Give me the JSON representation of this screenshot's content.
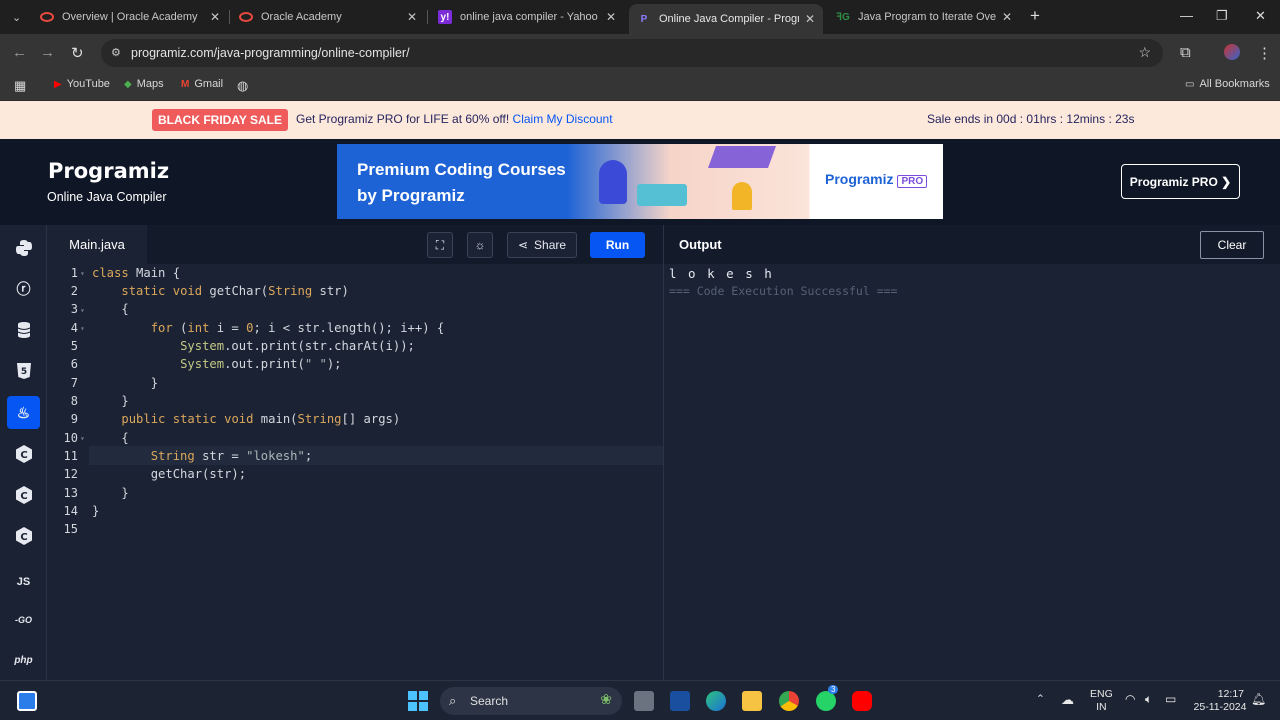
{
  "browser": {
    "tabs": [
      {
        "title": "Overview | Oracle Academy",
        "favicon": "oracle-icon",
        "color": "#e94a3f"
      },
      {
        "title": "Oracle Academy",
        "favicon": "oracle-icon",
        "color": "#e94a3f"
      },
      {
        "title": "online java compiler - Yahoo In",
        "favicon": "yahoo-icon",
        "color": "#7b2bd8"
      },
      {
        "title": "Online Java Compiler - Program",
        "favicon": "programiz-icon",
        "color": "#6a5bff"
      },
      {
        "title": "Java Program to Iterate Over Ch",
        "favicon": "gfg-icon",
        "color": "#2f8d46"
      }
    ],
    "url": "programiz.com/java-programming/online-compiler/",
    "bookmarks": [
      {
        "label": "YouTube",
        "icon": "youtube-icon"
      },
      {
        "label": "Maps",
        "icon": "maps-icon"
      },
      {
        "label": "Gmail",
        "icon": "gmail-icon"
      }
    ],
    "all_bookmarks": "All Bookmarks"
  },
  "promo": {
    "badge": "BLACK FRIDAY SALE",
    "text": "Get Programiz PRO for LIFE at 60% off!",
    "link": "Claim My Discount",
    "timer": "Sale ends in 00d : 01hrs : 12mins : 23s"
  },
  "header": {
    "logo": "Programiz",
    "subtitle": "Online Java Compiler",
    "ad_text": "Premium Coding Courses by Programiz",
    "ad_logo": "Programiz",
    "ad_pro": "PRO",
    "pro_button": "Programiz PRO ❯"
  },
  "editor": {
    "file_name": "Main.java",
    "share_label": "Share",
    "run_label": "Run",
    "line_numbers": [
      "1",
      "2",
      "3",
      "4",
      "5",
      "6",
      "7",
      "8",
      "9",
      "10",
      "11",
      "12",
      "13",
      "14",
      "15"
    ]
  },
  "output": {
    "title": "Output",
    "clear_label": "Clear",
    "line1": "l o k e s h",
    "line2": "=== Code Execution Successful ==="
  },
  "languages": [
    "python-icon",
    "r-icon",
    "sql-icon",
    "html5-icon",
    "java-icon",
    "c-icon",
    "cpp-icon",
    "csharp-icon",
    "js-icon",
    "go-icon",
    "php-icon"
  ],
  "taskbar": {
    "search_placeholder": "Search",
    "lang": "ENG",
    "region": "IN",
    "time": "12:17",
    "date": "25-11-2024",
    "whatsapp_badge": "3"
  }
}
